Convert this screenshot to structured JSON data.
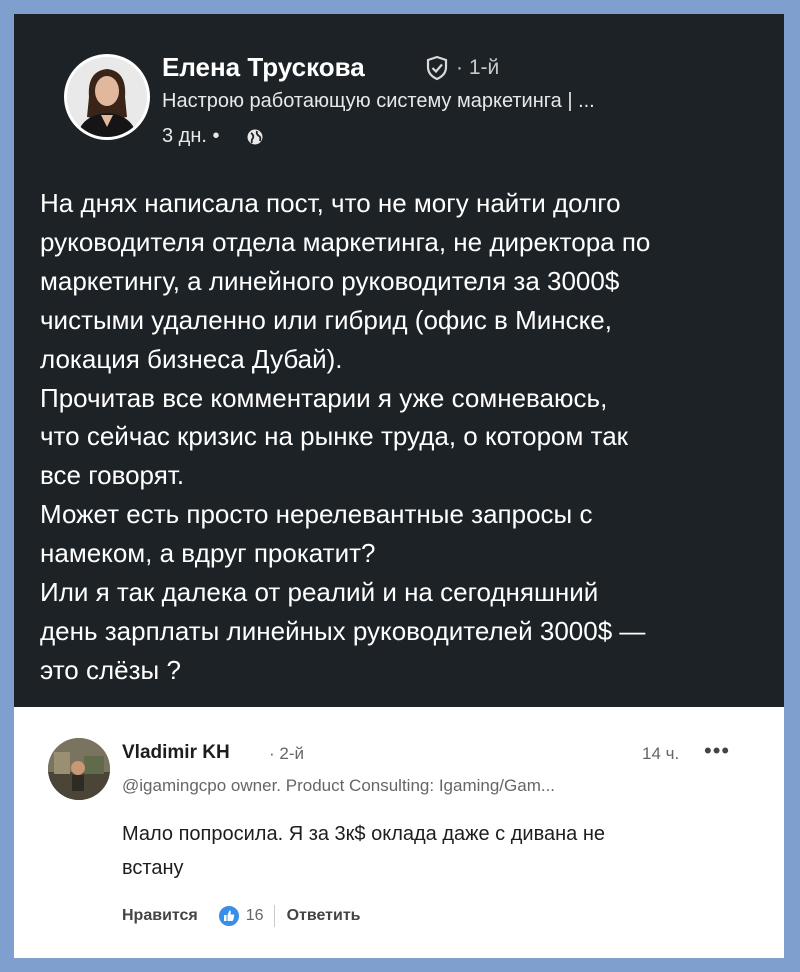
{
  "post": {
    "author": {
      "name": "Елена Трускова",
      "degree": "· 1-й",
      "headline": "Настрою работающую систему маркетинга | ...",
      "time": "3 дн. •",
      "visibility_icon": "globe-icon"
    },
    "text_lines": [
      "На днях написала пост, что не могу найти долго",
      "руководителя отдела маркетинга, не директора по",
      "маркетингу, а линейного руководителя за 3000$",
      "чистыми удаленно или гибрид (офис в Минске,",
      "локация бизнеса Дубай).",
      "Прочитав все комментарии я уже сомневаюсь,",
      "что сейчас кризис на рынке труда, о котором так",
      "все говорят.",
      "Может есть просто нерелевантные запросы с",
      "намеком, а вдруг прокатит?",
      "Или я так далека от реалий и на сегодняшний",
      "день зарплаты линейных руководителей 3000$ —",
      "это слёзы ?"
    ]
  },
  "comment": {
    "author": "Vladimir KH",
    "degree": "· 2-й",
    "time": "14 ч.",
    "more": "•••",
    "headline": "@igamingcpo owner. Product Consulting: Igaming/Gam...",
    "text_lines": [
      "Мало попросила. Я за 3к$ оклада даже с дивана не",
      "встану"
    ],
    "like_label": "Нравится",
    "like_count": "16",
    "reply_label": "Ответить"
  },
  "colors": {
    "post_bg": "#1d2226",
    "border": "#7f9fcf",
    "like_blue": "#378fe9"
  }
}
